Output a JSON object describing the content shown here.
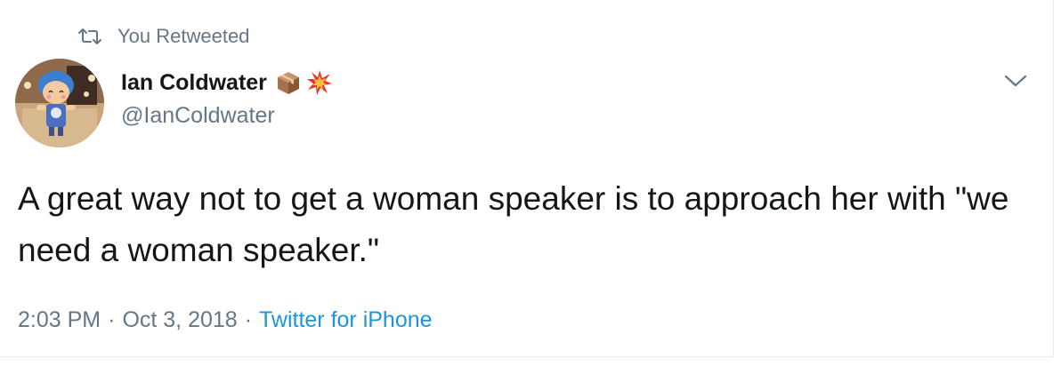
{
  "retweet": {
    "icon": "retweet-icon",
    "label": "You Retweeted"
  },
  "author": {
    "name": "Ian Coldwater",
    "handle": "@IanColdwater",
    "name_emojis": [
      "package-emoji",
      "collision-emoji"
    ]
  },
  "tweet": {
    "text": "A great way not to get a woman speaker is to approach her with \"we need a woman speaker.\""
  },
  "meta": {
    "time": "2:03 PM",
    "separator": "·",
    "date": "Oct 3, 2018",
    "source": "Twitter for iPhone"
  },
  "colors": {
    "text": "#14171a",
    "secondary": "#657786",
    "link": "#1b95e0",
    "border": "#e6ecf0"
  }
}
